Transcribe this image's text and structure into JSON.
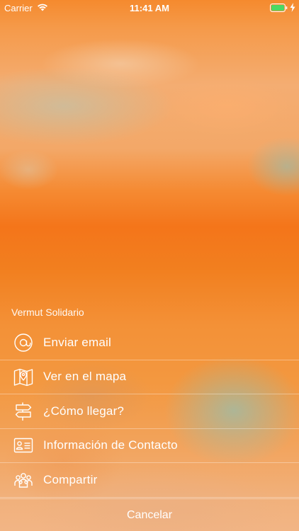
{
  "status_bar": {
    "carrier": "Carrier",
    "time": "11:41 AM",
    "battery_color": "#4cd964"
  },
  "sheet": {
    "title": "Vermut Solidario",
    "items": [
      {
        "label": "Enviar email",
        "icon": "at-sign-icon"
      },
      {
        "label": "Ver en el mapa",
        "icon": "map-pin-icon"
      },
      {
        "label": "¿Cómo llegar?",
        "icon": "signpost-icon"
      },
      {
        "label": "Información de Contacto",
        "icon": "contact-card-icon"
      },
      {
        "label": "Compartir",
        "icon": "people-icon"
      }
    ],
    "cancel_label": "Cancelar"
  },
  "theme": {
    "accent": "#f4751a",
    "text": "#ffffff"
  }
}
